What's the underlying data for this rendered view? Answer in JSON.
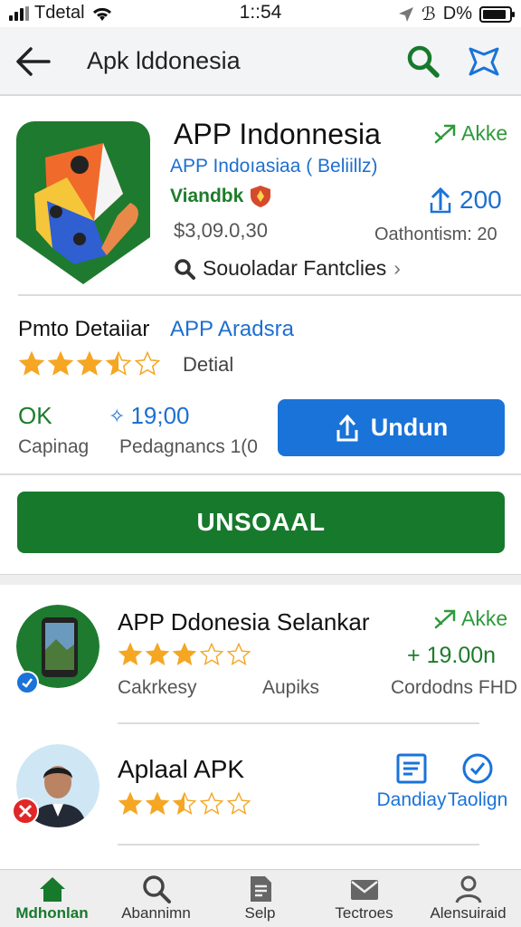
{
  "status_bar": {
    "carrier": "Tdetal",
    "time": "1::54",
    "battery_text": "D%",
    "battery_level": 0.9
  },
  "app_bar": {
    "title": "Apk lddonesia"
  },
  "app": {
    "name": "APP Indonnesia",
    "subtitle": "APP Indoıasiaa ( Beliillz)",
    "developer": "Viandbk",
    "price": "$3,09.0,30",
    "similar_label": "Souoladar Fantclies",
    "akke_label": "Akke",
    "download_count": "200",
    "optimism_text": "Oathontism: 20"
  },
  "detail": {
    "title": "Pmto Detaiiar",
    "link": "APP Aradsra",
    "rating": 3.5,
    "rating_label": "Detial",
    "ok_value": "OK",
    "ok_label": "Capinag",
    "dl_value": "19;00",
    "dl_label": "Pedagnancs 1(0",
    "undun_label": "Undun",
    "unsoaal_label": "UNSOAAL"
  },
  "related": [
    {
      "name": "APP Ddonesia Selankar",
      "rating": 3,
      "akke_label": "Akke",
      "price": "19.00n",
      "meta_1": "Cakrkesy",
      "meta_2": "Aupiks",
      "meta_3": "Cordodns FHD"
    },
    {
      "name": "Aplaal APK",
      "rating": 2.5,
      "action_1": "Dandiay",
      "action_2": "Taolign"
    }
  ],
  "tabs": [
    {
      "label": "Mdhonlan",
      "icon": "home-icon",
      "active": true
    },
    {
      "label": "Abannimn",
      "icon": "search-icon",
      "active": false
    },
    {
      "label": "Selp",
      "icon": "document-icon",
      "active": false
    },
    {
      "label": "Tectroes",
      "icon": "mail-icon",
      "active": false
    },
    {
      "label": "Alensuiraid",
      "icon": "user-icon",
      "active": false
    }
  ],
  "colors": {
    "green": "#17792c",
    "blue": "#1a73d8",
    "star": "#f5a623"
  }
}
